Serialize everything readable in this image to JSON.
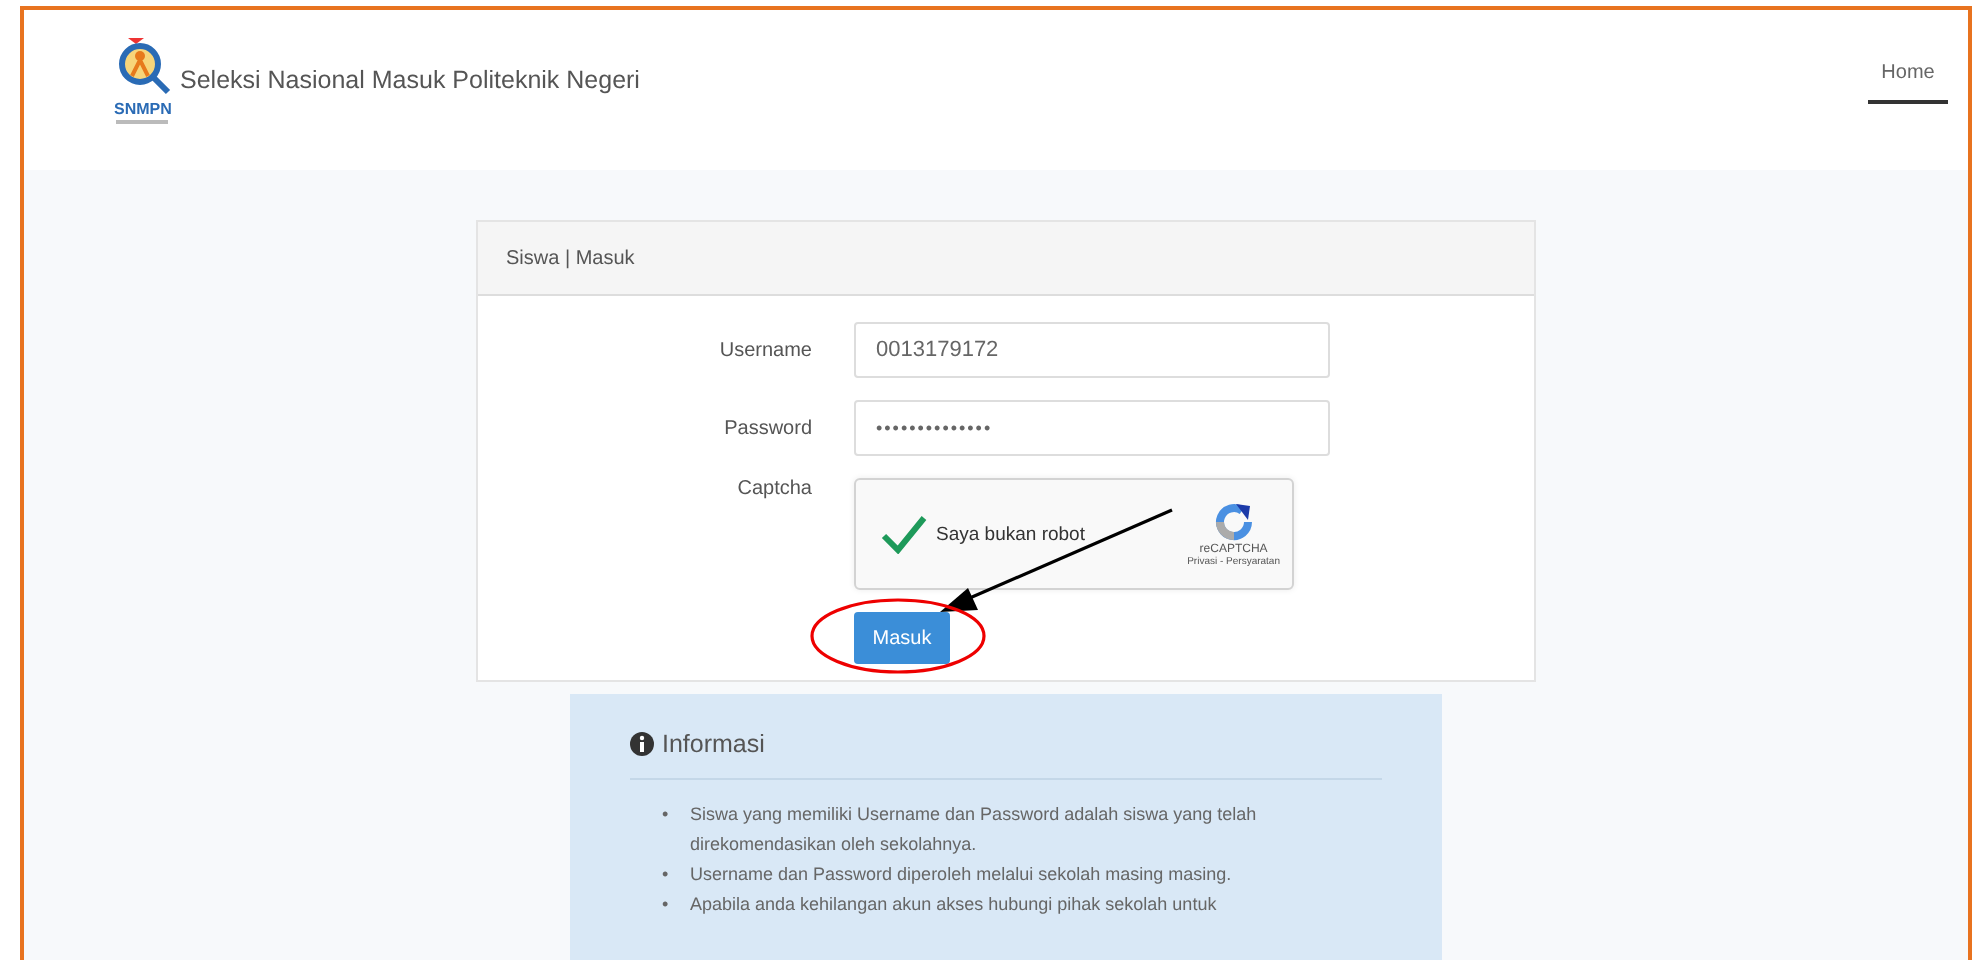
{
  "navbar": {
    "brand": {
      "logo_text": "SNMPN",
      "title": "Seleksi Nasional Masuk Politeknik Negeri"
    },
    "nav": [
      {
        "label": "Home",
        "selected": true
      }
    ]
  },
  "login_card": {
    "header": "Siswa | Masuk",
    "fields": [
      {
        "label": "Username",
        "kind": "text",
        "value": "0013179172"
      },
      {
        "label": "Password",
        "kind": "password",
        "value": "••••••••••••••"
      }
    ],
    "captcha": {
      "label": "Captcha",
      "checked": true,
      "text": "Saya bukan robot",
      "brand": "reCAPTCHA",
      "links": "Privasi - Persyaratan"
    },
    "submit": "Masuk"
  },
  "info": {
    "title": "Informasi",
    "items": [
      {
        "marker": "•",
        "text": "Siswa yang memiliki Username dan Password adalah siswa yang telah direkomendasikan oleh sekolahnya."
      },
      {
        "marker": "•",
        "text": "Username dan Password diperoleh melalui sekolah masing masing."
      },
      {
        "marker": "•",
        "text": "Apabila anda kehilangan akun akses hubungi pihak sekolah untuk"
      }
    ]
  },
  "annotations": [
    {
      "kind": "arrow"
    },
    {
      "kind": "ellipse"
    }
  ]
}
